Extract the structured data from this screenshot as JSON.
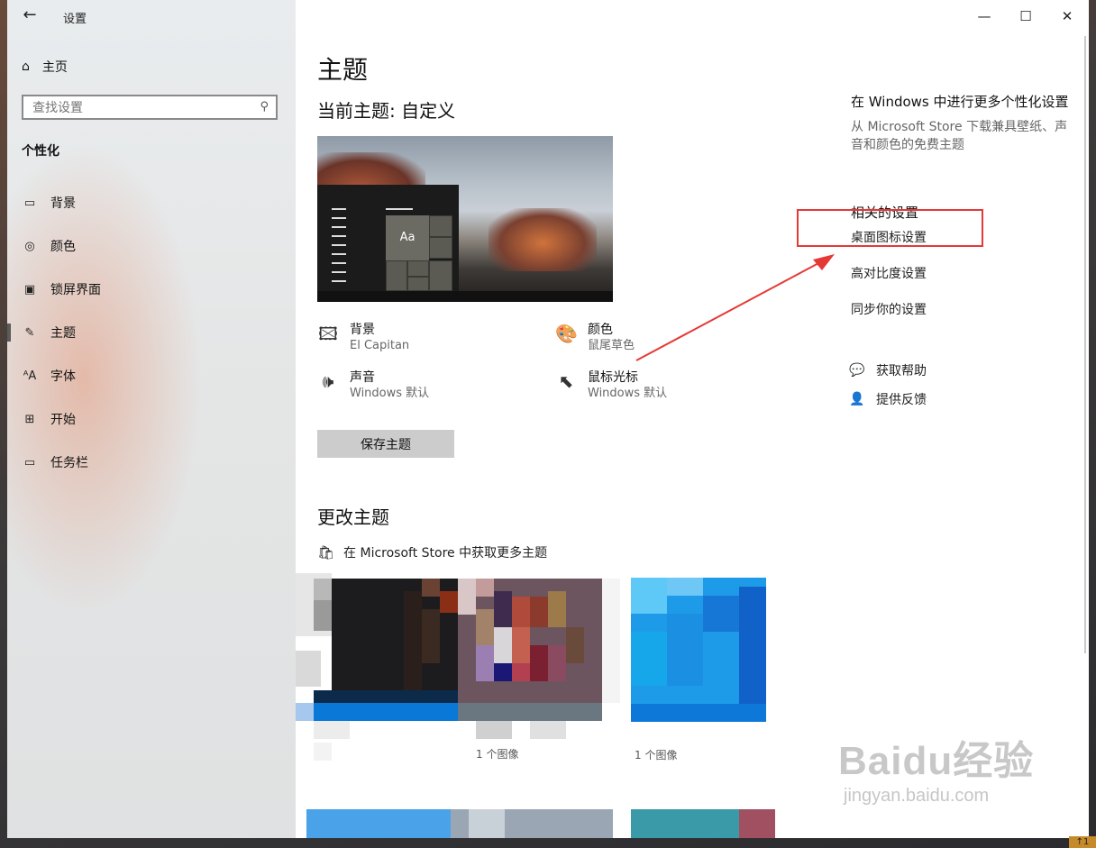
{
  "window": {
    "title": "设置"
  },
  "sidebar": {
    "home_label": "主页",
    "search_placeholder": "查找设置",
    "section_label": "个性化",
    "items": [
      {
        "label": "背景",
        "icon": "picture-icon"
      },
      {
        "label": "颜色",
        "icon": "palette-icon"
      },
      {
        "label": "锁屏界面",
        "icon": "lockscreen-icon"
      },
      {
        "label": "主题",
        "icon": "theme-icon",
        "active": true
      },
      {
        "label": "字体",
        "icon": "font-icon"
      },
      {
        "label": "开始",
        "icon": "start-icon"
      },
      {
        "label": "任务栏",
        "icon": "taskbar-icon"
      }
    ]
  },
  "main": {
    "title": "主题",
    "current_theme": "当前主题: 自定义",
    "preview_tile_text": "Aa",
    "properties": [
      {
        "title": "背景",
        "value": "El Capitan",
        "icon": "picture-icon"
      },
      {
        "title": "颜色",
        "value": "鼠尾草色",
        "icon": "palette-icon"
      },
      {
        "title": "声音",
        "value": "Windows 默认",
        "icon": "speaker-icon"
      },
      {
        "title": "鼠标光标",
        "value": "Windows 默认",
        "icon": "cursor-icon"
      }
    ],
    "save_button": "保存主题",
    "change_title": "更改主题",
    "store_link": "在 Microsoft Store 中获取更多主题",
    "themes": [
      {
        "caption": "1 个图像"
      },
      {
        "caption": "1 个图像"
      }
    ]
  },
  "right": {
    "store_title": "在 Windows 中进行更多个性化设置",
    "store_desc": "从 Microsoft Store 下载兼具壁纸、声音和颜色的免费主题",
    "related_title": "相关的设置",
    "links": [
      "桌面图标设置",
      "高对比度设置",
      "同步你的设置"
    ],
    "help": "获取帮助",
    "feedback": "提供反馈"
  },
  "watermark": {
    "brand": "Baidu经验",
    "url": "jingyan.baidu.com"
  },
  "corner_badge": "↑1",
  "colors": {
    "accent": "#0078d7",
    "highlight": "#e53935"
  }
}
